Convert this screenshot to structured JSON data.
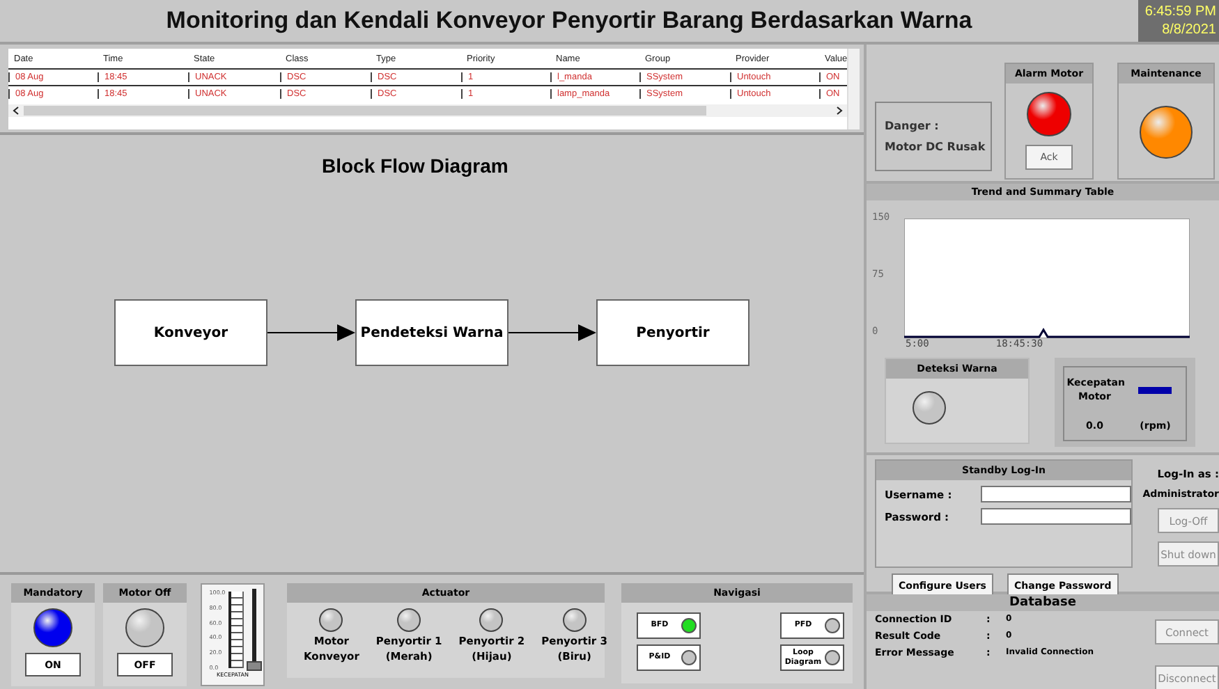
{
  "window": {
    "title": "Monitoring dan Kendali Konveyor Penyortir Barang Berdasarkan Warna",
    "time": "6:45:59 PM",
    "date": "8/8/2021"
  },
  "alarm_table": {
    "columns": [
      "Date",
      "Time",
      "State",
      "Class",
      "Type",
      "Priority",
      "Name",
      "Group",
      "Provider",
      "Value"
    ],
    "rows": [
      [
        "08 Aug",
        "18:45",
        "UNACK",
        "DSC",
        "DSC",
        "1",
        "l_manda",
        "SSystem",
        "Untouch",
        "ON"
      ],
      [
        "08 Aug",
        "18:45",
        "UNACK",
        "DSC",
        "DSC",
        "1",
        "lamp_manda",
        "SSystem",
        "Untouch",
        "ON"
      ]
    ]
  },
  "diagram": {
    "title": "Block Flow Diagram",
    "blocks": [
      "Konveyor",
      "Pendeteksi Warna",
      "Penyortir"
    ]
  },
  "controls": [
    {
      "title": "Mandatory",
      "lamp": {
        "on": true,
        "color": "#0000ee"
      },
      "button": "ON"
    },
    {
      "title": "Motor Off",
      "lamp": {
        "on": false
      },
      "button": "OFF"
    }
  ],
  "speed_slider": {
    "ticks": [
      "100.0",
      "80.0",
      "60.0",
      "40.0",
      "20.0",
      "0.0"
    ],
    "label": "KECEPATAN",
    "level": 0
  },
  "actuator": {
    "title": "Actuator",
    "items": [
      {
        "label": "Motor",
        "sublabel": "Konveyor",
        "on": false
      },
      {
        "label": "Penyortir 1",
        "sublabel": "(Merah)",
        "on": false
      },
      {
        "label": "Penyortir 2",
        "sublabel": "(Hijau)",
        "on": false
      },
      {
        "label": "Penyortir 3",
        "sublabel": "(Biru)",
        "on": false
      }
    ]
  },
  "navigation": {
    "title": "Navigasi",
    "items": [
      {
        "label": "BFD",
        "selected": true
      },
      {
        "label": "PFD",
        "selected": false
      },
      {
        "label": "P&ID",
        "selected": false
      },
      {
        "label": "Loop Diagram",
        "selected": false
      }
    ]
  },
  "alarm": {
    "danger_label": "Danger :",
    "danger_text": "Motor DC Rusak",
    "panels": [
      {
        "title": "Alarm Motor",
        "lamp": {
          "on": true,
          "color": "#ee0000"
        },
        "button": "Ack"
      },
      {
        "title": "Maintenance",
        "lamp": {
          "on": true,
          "color": "#ff8800"
        }
      }
    ]
  },
  "trend": {
    "title": "Trend and Summary Table",
    "yticks": [
      "150",
      "75",
      "0"
    ],
    "xticks": [
      "5:00",
      "18:45:30"
    ]
  },
  "color_detection": {
    "title": "Deteksi Warna",
    "lamp": {
      "on": false
    }
  },
  "motor_speed": {
    "label": "Kecepatan Motor",
    "value": "0.0",
    "unit": "(rpm)"
  },
  "login": {
    "title": "Standby Log-In",
    "fields": [
      {
        "label": "Username :"
      },
      {
        "label": "Password :"
      }
    ],
    "buttons": [
      "Configure Users",
      "Change Password"
    ],
    "logged_in_label": "Log-In as :",
    "user": "Administrator",
    "actions": [
      {
        "label": "Log-Off",
        "disabled": true
      },
      {
        "label": "Shut down",
        "disabled": true
      }
    ]
  },
  "database": {
    "title": "Database",
    "rows": [
      {
        "label": "Connection ID",
        "sep": ":",
        "value": "0"
      },
      {
        "label": "Result Code",
        "sep": ":",
        "value": "0"
      },
      {
        "label": "Error Message",
        "sep": ":",
        "value": "Invalid Connection"
      }
    ],
    "actions": [
      {
        "label": "Connect",
        "disabled": true
      },
      {
        "label": "Disconnect",
        "disabled": true
      }
    ]
  }
}
